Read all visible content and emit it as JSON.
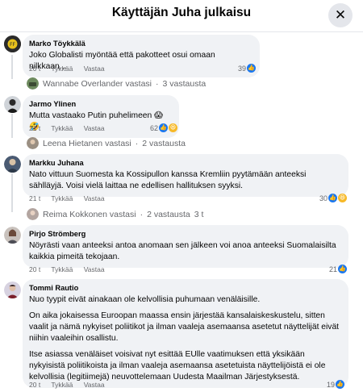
{
  "header": {
    "title": "Käyttäjän Juha julkaisu",
    "close_icon": "close-icon"
  },
  "comments": [
    {
      "author": "Marko Töykkälä",
      "text": "Joko Globalisti myöntää että pakotteet osui omaan nilkkaan...",
      "time": "20 t",
      "like_label": "Tykkää",
      "reply_label": "Vastaa",
      "reaction_count": "39",
      "reply": {
        "name": "Wannabe Overlander vastasi",
        "sep": "·",
        "count": "3 vastausta"
      }
    },
    {
      "author": "Jarmo Ylinen",
      "text": "Mutta vastaako Putin puhelimeen 😱🤣",
      "time": "21 t",
      "like_label": "Tykkää",
      "reply_label": "Vastaa",
      "reaction_count": "62",
      "reply": {
        "name": "Leena Hietanen vastasi",
        "sep": "·",
        "count": "2 vastausta"
      }
    },
    {
      "author": "Markku Juhana",
      "text": "Nato vittuun Suomesta ka Kossipullon kanssa Kremliin pyytämään anteeksi sählläyjä. Voisi vielä laittaa ne edellisen hallituksen syyksi.",
      "time": "21 t",
      "like_label": "Tykkää",
      "reply_label": "Vastaa",
      "reaction_count": "30",
      "reply": {
        "name": "Reima Kokkonen vastasi",
        "sep": "·",
        "count": "2 vastausta",
        "time": "3 t"
      }
    },
    {
      "author": "Pirjo Strömberg",
      "text": "Nöyrästi vaan anteeksi antoa anomaan sen jälkeen voi anoa anteeksi Suomalaisilta kaikkia pimeitä tekojaan.",
      "time": "20 t",
      "like_label": "Tykkää",
      "reply_label": "Vastaa",
      "reaction_count": "21"
    },
    {
      "author": "Tommi Rautio",
      "paragraphs": [
        "Nuo tyypit eivät ainakaan ole kelvollisia puhumaan venäläisille.",
        "On aika jokaisessa Euroopan maassa ensin järjestää kansalaiskeskustelu, sitten vaalit ja nämä nykyiset poliitikot ja ilman vaaleja asemaansa asetetut näyttelijät eivät niihin vaaleihin osallistu.",
        "Itse asiassa venäläiset voisivat nyt esittää EUlle vaatimuksen että yksikään nykyisistä poliitikoista ja ilman vaaleja asemaansa asetetuista näyttelijöistä ei ole kelvollisia (legitiimejä) neuvottelemaan Uudesta Maailman Järjestyksestä."
      ],
      "time": "20 t",
      "like_label": "Tykkää",
      "reply_label": "Vastaa",
      "reaction_count": "19"
    }
  ],
  "colors": {
    "like": "#1877f2",
    "haha": "#f7b928",
    "bubble": "#f0f2f5",
    "meta": "#65676b"
  }
}
